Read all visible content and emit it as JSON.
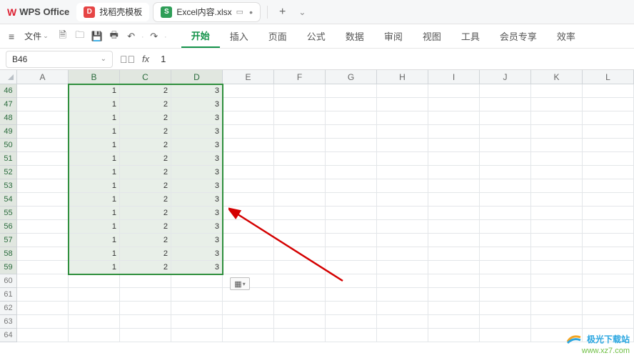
{
  "app": {
    "name": "WPS Office"
  },
  "tabs": {
    "docer": {
      "label": "找稻壳模板"
    },
    "file": {
      "label": "Excel内容.xlsx"
    },
    "add": {
      "label": "+"
    }
  },
  "toolbar": {
    "file_label": "文件",
    "menus": [
      "开始",
      "插入",
      "页面",
      "公式",
      "数据",
      "审阅",
      "视图",
      "工具",
      "会员专享",
      "效率"
    ],
    "active_menu_index": 0
  },
  "namebox": {
    "value": "B46"
  },
  "formula": {
    "fx": "fx",
    "value": "1"
  },
  "columns": [
    "A",
    "B",
    "C",
    "D",
    "E",
    "F",
    "G",
    "H",
    "I",
    "J",
    "K",
    "L"
  ],
  "rows": [
    46,
    47,
    48,
    49,
    50,
    51,
    52,
    53,
    54,
    55,
    56,
    57,
    58,
    59,
    60,
    61,
    62,
    63,
    64
  ],
  "selection": {
    "col_start": 1,
    "col_end": 3,
    "row_start": 0,
    "row_end": 13
  },
  "data_cols": [
    1,
    2,
    3
  ],
  "data_values": {
    "1": "1",
    "2": "2",
    "3": "3"
  },
  "data_row_start": 0,
  "data_row_end": 13,
  "smart_tag": {
    "glyph": "▦",
    "caret": "▾"
  },
  "watermark": {
    "title": "极光下载站",
    "url": "www.xz7.com"
  }
}
